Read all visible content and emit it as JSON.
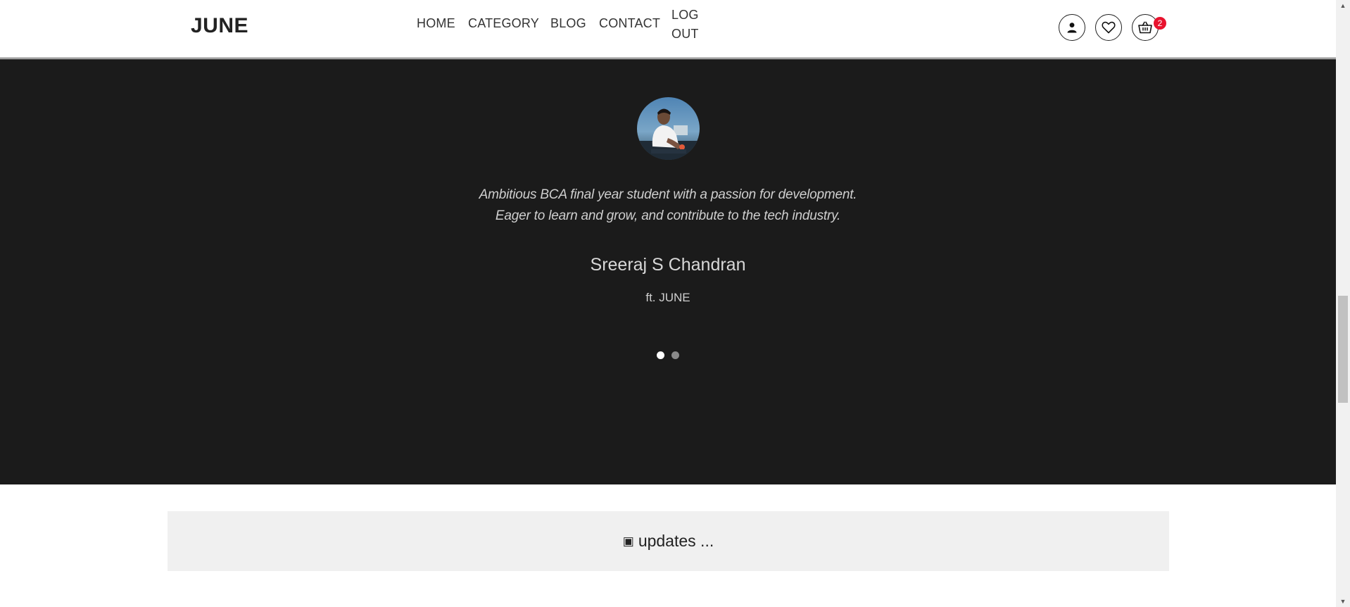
{
  "header": {
    "logo": "JUNE",
    "nav": [
      {
        "label": "HOME"
      },
      {
        "label": "CATEGORY"
      },
      {
        "label": "BLOG"
      },
      {
        "label": "CONTACT"
      },
      {
        "label": "LOG OUT"
      }
    ],
    "icons": [
      "user-icon",
      "heart-icon",
      "cart-icon"
    ],
    "cart_count": "2"
  },
  "testimonial": {
    "quote_line1": "Ambitious BCA final year student with a passion for development.",
    "quote_line2": "Eager to learn and grow, and contribute to the tech industry.",
    "name": "Sreeraj S Chandran",
    "subtitle": "ft. JUNE",
    "slides_count": 2,
    "active_slide": 1
  },
  "updates": {
    "icon": "▣",
    "text": "updates ..."
  },
  "colors": {
    "dark_section_bg": "#1b1b1b",
    "badge_bg": "#e8132e",
    "updates_bg": "#f0f0f0"
  }
}
